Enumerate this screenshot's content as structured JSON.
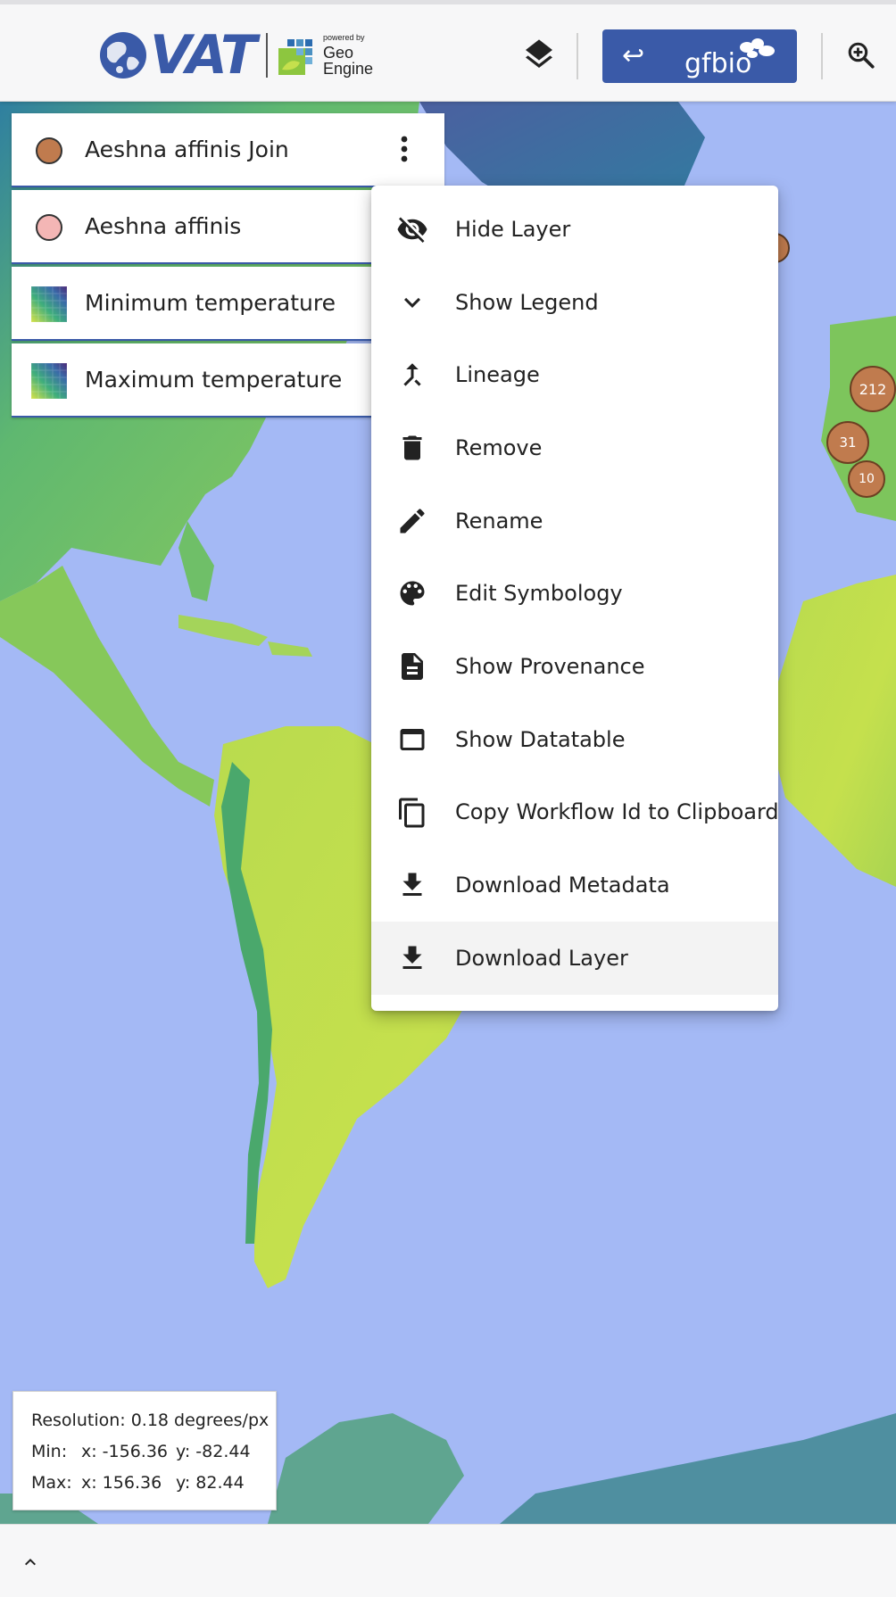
{
  "header": {
    "brand_text": "VAT",
    "powered_by": "powered by",
    "geo_engine_line1": "Geo",
    "geo_engine_line2": "Engine",
    "gfbio_label": "gfbio",
    "gfbio_arrow": "↩"
  },
  "layers": [
    {
      "name": "Aeshna affinis Join",
      "symbol": "point",
      "color": "#c07b4e"
    },
    {
      "name": "Aeshna affinis",
      "symbol": "point",
      "color": "#f4b6b5"
    },
    {
      "name": "Minimum temperature",
      "symbol": "raster"
    },
    {
      "name": "Maximum temperature",
      "symbol": "raster"
    }
  ],
  "context_menu": {
    "items": [
      {
        "label": "Hide Layer",
        "icon": "visibility-off-icon"
      },
      {
        "label": "Show Legend",
        "icon": "chevron-down-icon"
      },
      {
        "label": "Lineage",
        "icon": "merge-icon"
      },
      {
        "label": "Remove",
        "icon": "trash-icon"
      },
      {
        "label": "Rename",
        "icon": "pencil-icon"
      },
      {
        "label": "Edit Symbology",
        "icon": "palette-icon"
      },
      {
        "label": "Show Provenance",
        "icon": "document-icon"
      },
      {
        "label": "Show Datatable",
        "icon": "window-icon"
      },
      {
        "label": "Copy Workflow Id to Clipboard",
        "icon": "copy-icon"
      },
      {
        "label": "Download Metadata",
        "icon": "download-icon"
      },
      {
        "label": "Download Layer",
        "icon": "download-icon",
        "highlighted": true
      }
    ]
  },
  "map": {
    "clusters": [
      "212",
      "31",
      "10"
    ],
    "colors": {
      "ocean": "#a4b9f5",
      "land_low": "#c3e04e",
      "land_high": "#3eaa6c",
      "cluster": "#c07b4e"
    }
  },
  "info": {
    "resolution": "Resolution: 0.18 degrees/px",
    "min_label": "Min:",
    "min_x": "x: -156.36",
    "min_y": "y: -82.44",
    "max_label": "Max:",
    "max_x": "x: 156.36",
    "max_y": "y: 82.44"
  },
  "colors": {
    "accent": "#3a5aa8"
  }
}
